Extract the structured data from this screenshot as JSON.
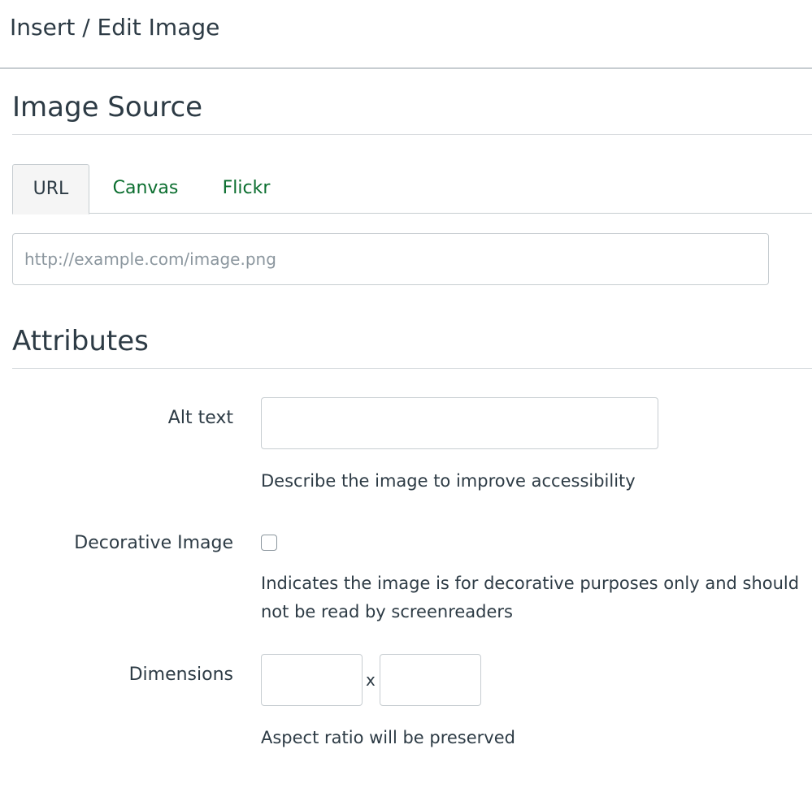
{
  "dialog": {
    "title": "Insert / Edit Image"
  },
  "image_source": {
    "heading": "Image Source",
    "tabs": [
      {
        "label": "URL",
        "active": true
      },
      {
        "label": "Canvas",
        "active": false
      },
      {
        "label": "Flickr",
        "active": false
      }
    ],
    "url_input": {
      "value": "",
      "placeholder": "http://example.com/image.png"
    }
  },
  "attributes": {
    "heading": "Attributes",
    "alt_text": {
      "label": "Alt text",
      "value": "",
      "hint": "Describe the image to improve accessibility"
    },
    "decorative": {
      "label": "Decorative Image",
      "checked": false,
      "hint": "Indicates the image is for decorative purposes only and should not be read by screenreaders"
    },
    "dimensions": {
      "label": "Dimensions",
      "width": "",
      "height": "",
      "separator": "x",
      "hint": "Aspect ratio will be preserved"
    }
  },
  "colors": {
    "text": "#2d3b45",
    "link": "#0b6e2f",
    "border": "#c7cdd1",
    "placeholder": "#8b969e"
  }
}
